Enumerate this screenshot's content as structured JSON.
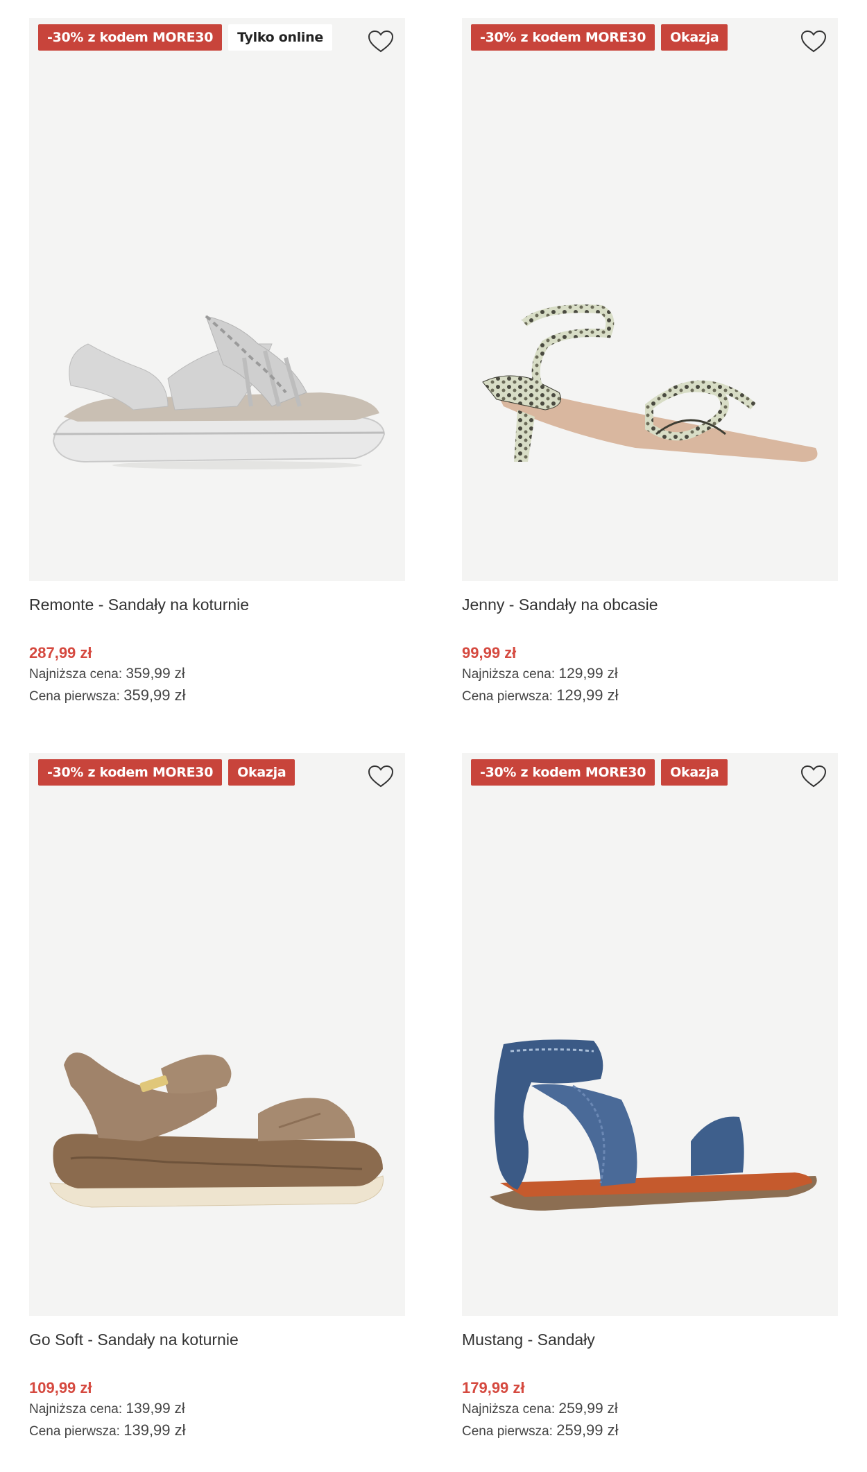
{
  "products": [
    {
      "badges": [
        {
          "text": "-30% z kodem MORE30",
          "style": "red"
        },
        {
          "text": "Tylko online",
          "style": "white"
        }
      ],
      "name": "Remonte - Sandały na koturnie",
      "price": "287,99 zł",
      "lowest_label": "Najniższa cena:",
      "lowest_value": "359,99 zł",
      "first_label": "Cena pierwsza:",
      "first_value": "359,99 zł",
      "image_icon": "silver-wedge-sandal"
    },
    {
      "badges": [
        {
          "text": "-30% z kodem MORE30",
          "style": "red"
        },
        {
          "text": "Okazja",
          "style": "red"
        }
      ],
      "name": "Jenny - Sandały na obcasie",
      "price": "99,99 zł",
      "lowest_label": "Najniższa cena:",
      "lowest_value": "129,99 zł",
      "first_label": "Cena pierwsza:",
      "first_value": "129,99 zł",
      "image_icon": "snakeskin-heel-sandal"
    },
    {
      "badges": [
        {
          "text": "-30% z kodem MORE30",
          "style": "red"
        },
        {
          "text": "Okazja",
          "style": "red"
        }
      ],
      "name": "Go Soft - Sandały na koturnie",
      "price": "109,99 zł",
      "lowest_label": "Najniższa cena:",
      "lowest_value": "139,99 zł",
      "first_label": "Cena pierwsza:",
      "first_value": "139,99 zł",
      "image_icon": "brown-wedge-sandal"
    },
    {
      "badges": [
        {
          "text": "-30% z kodem MORE30",
          "style": "red"
        },
        {
          "text": "Okazja",
          "style": "red"
        }
      ],
      "name": "Mustang - Sandały",
      "price": "179,99 zł",
      "lowest_label": "Najniższa cena:",
      "lowest_value": "259,99 zł",
      "first_label": "Cena pierwsza:",
      "first_value": "259,99 zł",
      "image_icon": "denim-flat-sandal"
    }
  ],
  "colors": {
    "badge_red": "#c8443b",
    "price_red": "#d5493f",
    "image_bg": "#f4f4f3"
  }
}
